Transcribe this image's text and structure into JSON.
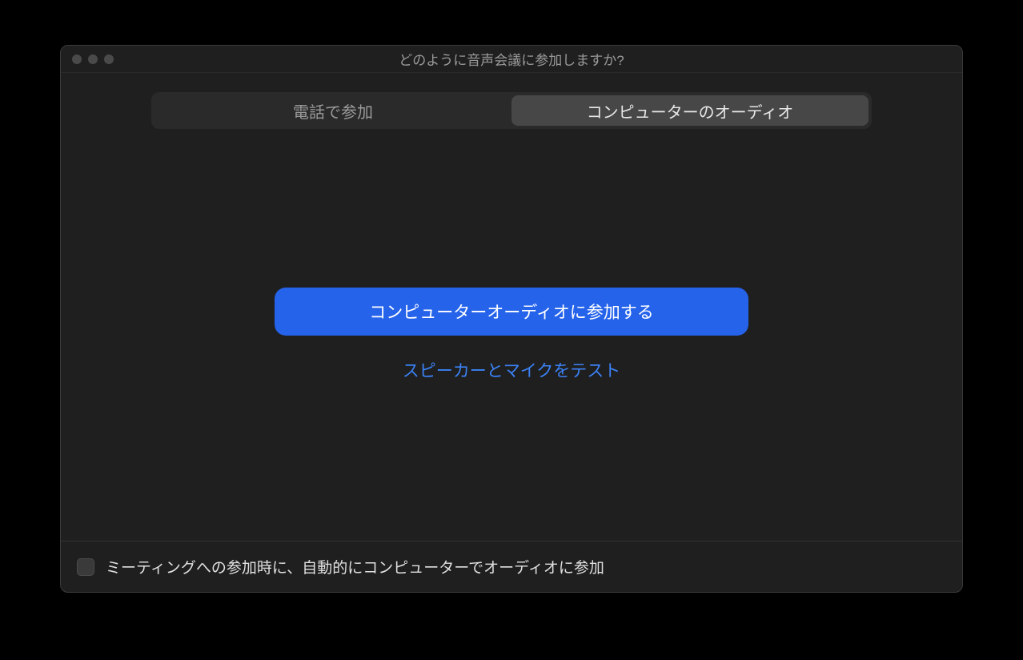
{
  "window": {
    "title": "どのように音声会議に参加しますか?"
  },
  "tabs": {
    "phone": "電話で参加",
    "computer_audio": "コンピューターのオーディオ"
  },
  "main": {
    "join_button": "コンピューターオーディオに参加する",
    "test_link": "スピーカーとマイクをテスト"
  },
  "footer": {
    "auto_join_label": "ミーティングへの参加時に、自動的にコンピューターでオーディオに参加"
  }
}
